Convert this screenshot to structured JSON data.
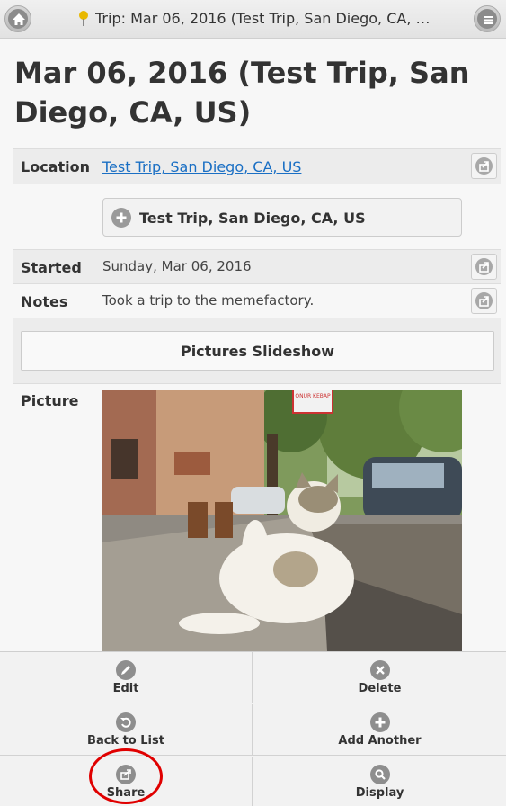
{
  "header": {
    "title": "Trip: Mar 06, 2016 (Test Trip, San Diego, CA, US)",
    "home_icon": "home-icon",
    "menu_icon": "menu-icon"
  },
  "page": {
    "title": "Mar 06, 2016 (Test Trip, San Diego, CA, US)"
  },
  "fields": {
    "location_label": "Location",
    "location_value": "Test Trip, San Diego, CA, US",
    "location_button": "Test Trip, San Diego, CA, US",
    "started_label": "Started",
    "started_value": "Sunday, Mar 06, 2016",
    "notes_label": "Notes",
    "notes_value": "Took a trip to the memefactory.",
    "slideshow_label": "Pictures Slideshow",
    "picture_label": "Picture"
  },
  "picture": {
    "sign_text": "ONUR KEBAP"
  },
  "footer": {
    "edit": "Edit",
    "delete": "Delete",
    "back": "Back to List",
    "add": "Add Another",
    "share": "Share",
    "display": "Display"
  },
  "colors": {
    "link": "#1a6fc4",
    "annotation": "#e00000"
  }
}
